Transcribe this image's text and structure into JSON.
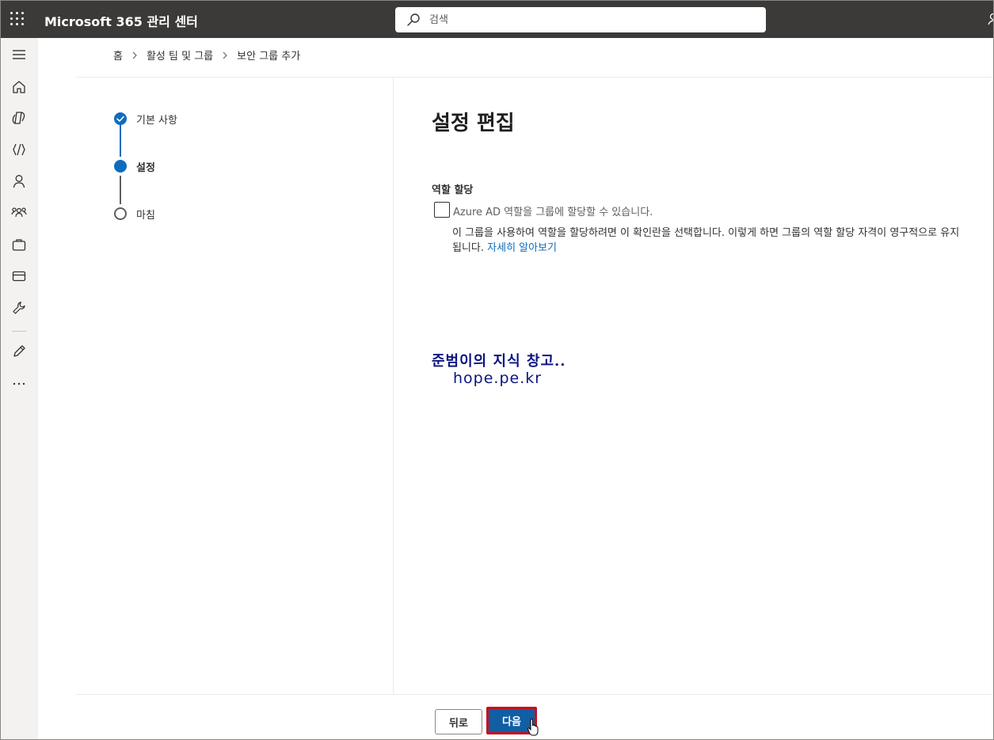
{
  "header": {
    "app_title": "Microsoft 365 관리 센터",
    "search_placeholder": "검색"
  },
  "breadcrumb": {
    "items": [
      "홈",
      "활성 팀 및 그룹",
      "보안 그룹 추가"
    ]
  },
  "left_nav": {
    "icons": [
      "menu-icon",
      "home-icon",
      "copilot-icon",
      "viva-icon",
      "user-icon",
      "groups-icon",
      "briefcase-icon",
      "billing-icon",
      "wrench-icon",
      "pencil-icon",
      "more-icon"
    ]
  },
  "wizard": {
    "steps": [
      {
        "label": "기본 사항",
        "status": "completed"
      },
      {
        "label": "설정",
        "status": "current"
      },
      {
        "label": "마침",
        "status": "not-started"
      }
    ]
  },
  "main": {
    "title": "설정 편집",
    "section_label": "역할 할당",
    "checkbox_label": "Azure AD 역할을 그룹에 할당할 수 있습니다.",
    "checkbox_checked": false,
    "help_line1": "이 그룹을 사용하여 역할을 할당하려면 이 확인란을 선택합니다. 이렇게 하면 그룹의 역할 할당 자격이 영구적으로 유지",
    "help_line2_prefix": "됩니다. ",
    "learn_more": "자세히 알아보기"
  },
  "watermark": {
    "line1": "준범이의 지식 창고..",
    "line2": "hope.pe.kr"
  },
  "footer": {
    "back_label": "뒤로",
    "next_label": "다음"
  },
  "colors": {
    "topbar": "#3b3a39",
    "accent": "#0f6cbd",
    "next_button": "#115ea3",
    "highlight_border": "#c50f1f",
    "watermark": "#0b1480"
  }
}
